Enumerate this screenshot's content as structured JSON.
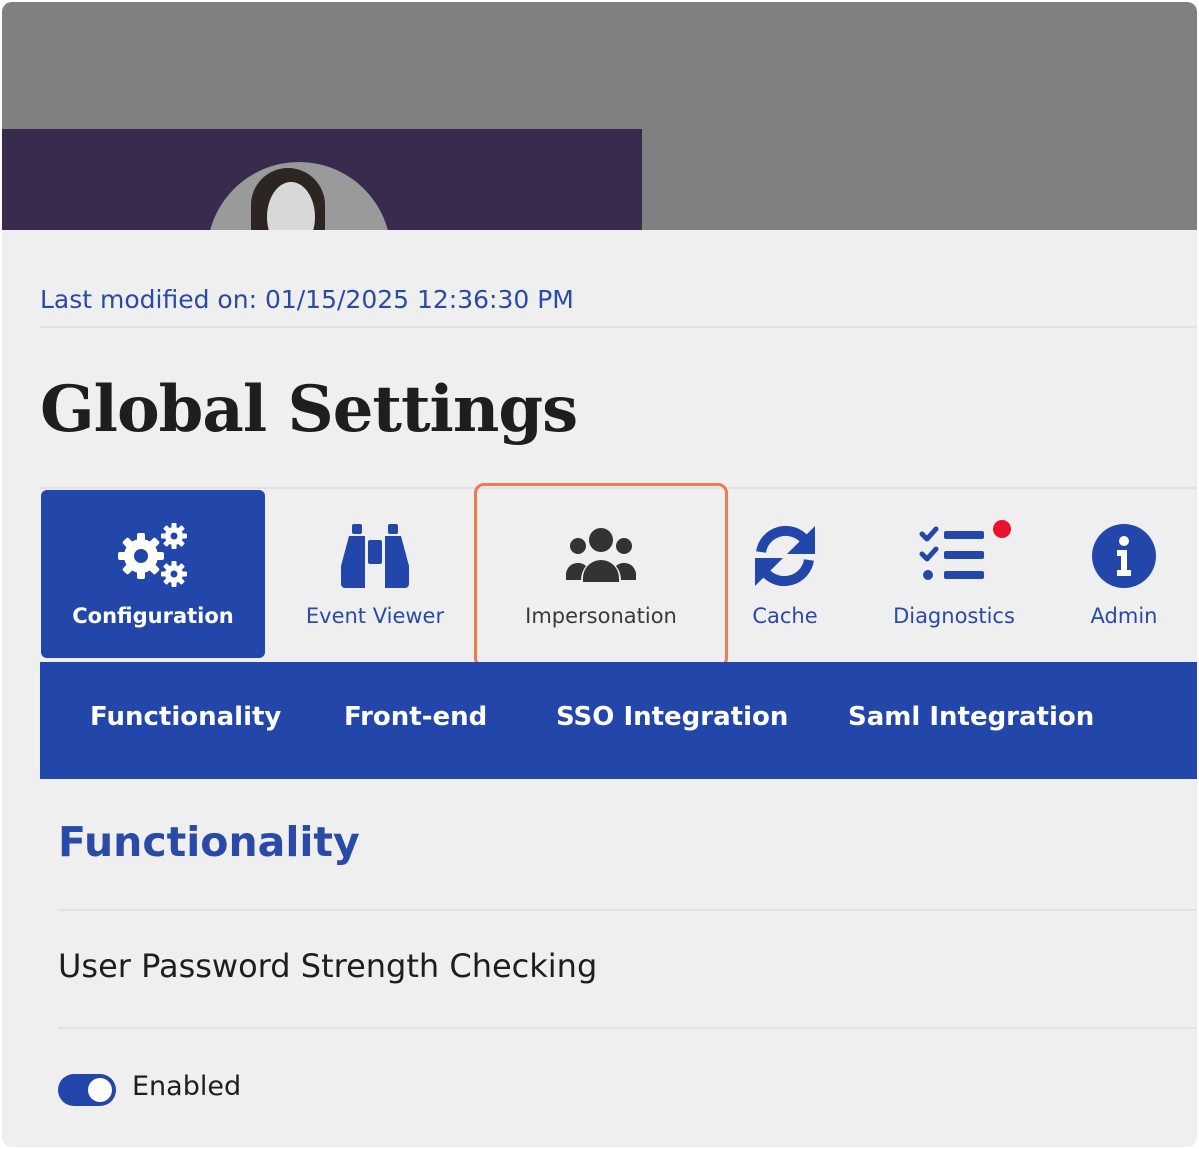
{
  "header": {
    "last_modified": "Last modified on: 01/15/2025 12:36:30 PM",
    "title": "Global Settings"
  },
  "tabs": [
    {
      "label": "Configuration",
      "icon": "gears-icon",
      "active": true
    },
    {
      "label": "Event Viewer",
      "icon": "binoculars-icon",
      "active": false
    },
    {
      "label": "Impersonation",
      "icon": "users-icon",
      "active": false,
      "highlighted": true
    },
    {
      "label": "Cache",
      "icon": "sync-icon",
      "active": false
    },
    {
      "label": "Diagnostics",
      "icon": "checklist-icon",
      "active": false,
      "has_notification": true
    },
    {
      "label": "Admin",
      "icon": "info-icon",
      "active": false
    }
  ],
  "subnav": {
    "items": [
      "Functionality",
      "Front-end",
      "SSO Integration",
      "Saml Integration"
    ]
  },
  "section": {
    "title": "Functionality",
    "setting_label": "User Password Strength Checking",
    "toggle_label": "Enabled",
    "toggle_on": true
  },
  "colors": {
    "accent": "#2346ab",
    "highlight": "#f07a4e",
    "notification": "#e6142e",
    "banner": "#392b4d"
  }
}
